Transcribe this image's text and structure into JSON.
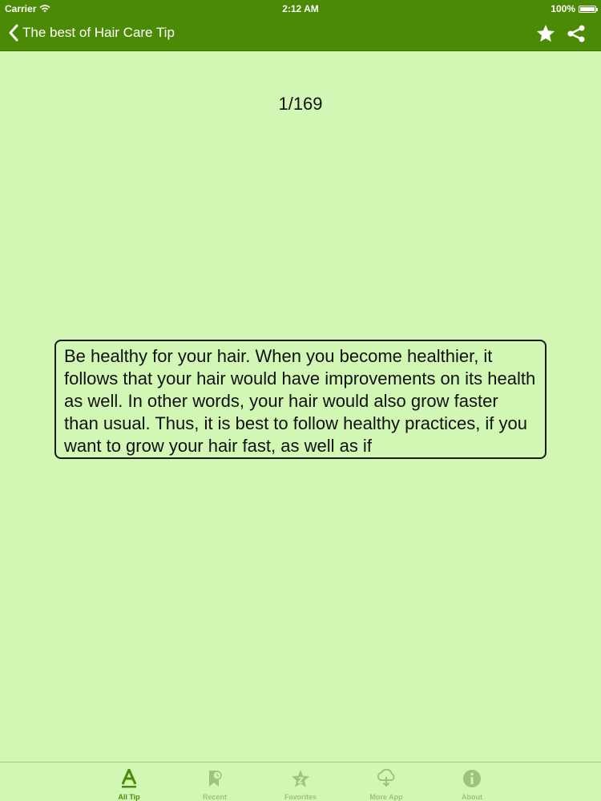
{
  "status_bar": {
    "carrier": "Carrier",
    "time": "2:12 AM",
    "battery": "100%",
    "battery_level": 1.0
  },
  "nav": {
    "back_label": "The best of Hair Care Tip",
    "back_icon": "chevron-left-icon",
    "favorite_icon": "star-icon",
    "share_icon": "share-icon"
  },
  "main": {
    "counter": "1/169",
    "tip_text": "Be healthy for your hair. When you become healthier, it follows that your hair would have improvements on its health as well. In other words, your hair would also grow faster than usual. Thus, it is best to follow healthy practices, if you want to grow your hair fast, as well as if"
  },
  "tabs": [
    {
      "label": "All Tip",
      "icon": "letter-a-icon",
      "active": true
    },
    {
      "label": "Recent",
      "icon": "recent-icon",
      "active": false
    },
    {
      "label": "Favorites",
      "icon": "favorites-star-icon",
      "active": false
    },
    {
      "label": "More App",
      "icon": "cloud-download-icon",
      "active": false
    },
    {
      "label": "About",
      "icon": "info-icon",
      "active": false
    }
  ],
  "colors": {
    "bar_green": "#4b8a05",
    "background": "#d2f7b4",
    "tab_active": "#4b8a05",
    "tab_inactive": "#9fc27f"
  }
}
